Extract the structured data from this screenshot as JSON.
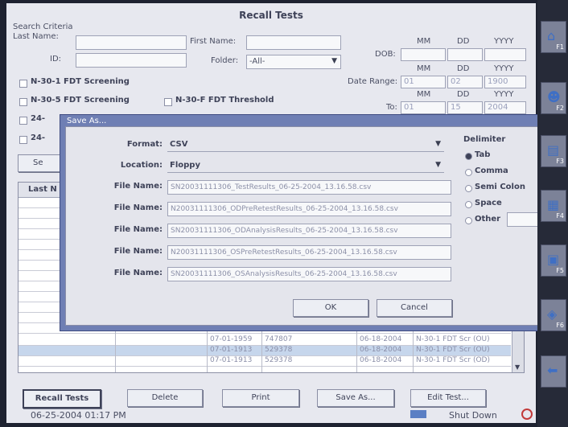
{
  "window_title": "Recall Tests",
  "search": {
    "group_label": "Search Criteria",
    "last_name_label": "Last Name:",
    "first_name_label": "First Name:",
    "id_label": "ID:",
    "folder_label": "Folder:",
    "folder_value": "-All-",
    "dob_label": "DOB:",
    "date_range_label": "Date Range:",
    "col_mm": "MM",
    "col_dd": "DD",
    "col_yyyy": "YYYY",
    "date_range_from_mm": "01",
    "date_range_from_dd": "02",
    "date_range_from_yyyy": "1900",
    "to_label": "To:",
    "date_range_to_mm": "01",
    "date_range_to_dd": "15",
    "date_range_to_yyyy": "2004",
    "checks": [
      "N-30-1 FDT Screening",
      "N-30-5 FDT Screening",
      "N-30-F FDT Threshold",
      "24-",
      "24-"
    ],
    "search_button": "Se"
  },
  "table": {
    "header_first": "Last N",
    "rows": [
      {
        "dob": "07-01-1959",
        "id": "747807",
        "date": "06-18-2004",
        "type": "N-30-1 FDT Scr (OU)"
      },
      {
        "dob": "07-01-1913",
        "id": "529378",
        "date": "06-18-2004",
        "type": "N-30-1 FDT Scr (OU)"
      },
      {
        "dob": "07-01-1913",
        "id": "529378",
        "date": "06-18-2004",
        "type": "N-30-1 FDT Scr (OD)"
      }
    ]
  },
  "dialog": {
    "title": "Save As...",
    "format_label": "Format:",
    "format_value": "CSV",
    "location_label": "Location:",
    "location_value": "Floppy",
    "file_name_label": "File Name:",
    "file_names": [
      "SN20031111306_TestResults_06-25-2004_13.16.58.csv",
      "N20031111306_ODPreRetestResults_06-25-2004_13.16.58.csv",
      "SN20031111306_ODAnalysisResults_06-25-2004_13.16.58.csv",
      "N20031111306_OSPreRetestResults_06-25-2004_13.16.58.csv",
      "SN20031111306_OSAnalysisResults_06-25-2004_13.16.58.csv"
    ],
    "delimiter_label": "Delimiter",
    "delimiters": [
      "Tab",
      "Comma",
      "Semi Colon",
      "Space",
      "Other"
    ],
    "ok_button": "OK",
    "cancel_button": "Cancel"
  },
  "bottom_buttons": {
    "recall": "Recall Tests",
    "delete": "Delete",
    "print": "Print",
    "save_as": "Save As...",
    "edit_test": "Edit Test..."
  },
  "status": {
    "datetime": "06-25-2004 01:17 PM",
    "shutdown": "Shut Down"
  },
  "fkeys": [
    "F1",
    "F2",
    "F3",
    "F4",
    "F5",
    "F6"
  ]
}
